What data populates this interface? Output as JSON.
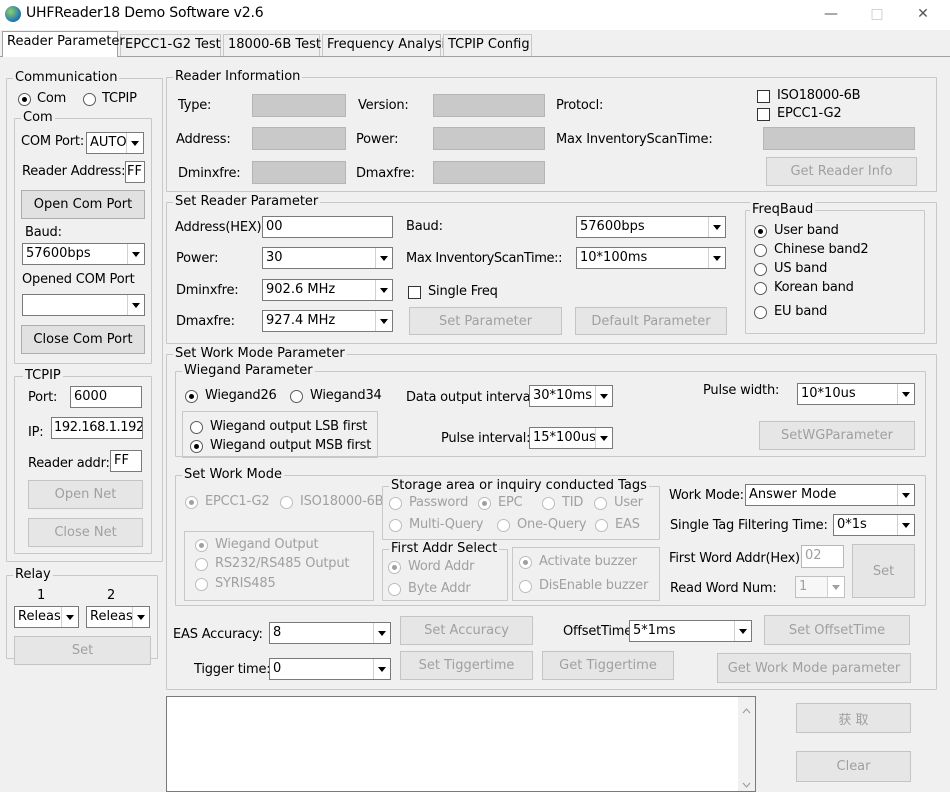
{
  "window": {
    "title": "UHFReader18 Demo Software v2.6",
    "controls": {
      "minimize": "—",
      "maximize": "□",
      "close": "✕"
    }
  },
  "tabs": [
    "Reader Parameter",
    "EPCC1-G2 Test",
    "18000-6B Test",
    "Frequency Analysis",
    "TCPIP Config"
  ],
  "communication": {
    "title": "Communication",
    "mode_com": "Com",
    "mode_tcpip": "TCPIP",
    "com": {
      "title": "Com",
      "com_port_label": "COM Port:",
      "com_port_value": "AUTO",
      "reader_address_label": "Reader Address:",
      "reader_address_value": "FF",
      "open_btn": "Open Com Port",
      "baud_label": "Baud:",
      "baud_value": "57600bps",
      "opened_label": "Opened COM Port",
      "opened_value": "",
      "close_btn": "Close Com Port"
    },
    "tcpip": {
      "title": "TCPIP",
      "port_label": "Port:",
      "port_value": "6000",
      "ip_label": "IP:",
      "ip_value": "192.168.1.192",
      "addr_label": "Reader addr:",
      "addr_value": "FF",
      "open_btn": "Open Net",
      "close_btn": "Close Net"
    }
  },
  "relay": {
    "title": "Relay",
    "col1": "1",
    "col2": "2",
    "relay1_value": "Release",
    "relay2_value": "Release",
    "set_btn": "Set"
  },
  "reader_info": {
    "title": "Reader Information",
    "type_label": "Type:",
    "version_label": "Version:",
    "protocol_label": "Protocl:",
    "address_label": "Address:",
    "power_label": "Power:",
    "max_scan_label": "Max InventoryScanTime:",
    "dminfre_label": "Dminxfre:",
    "dmaxfre_label": "Dmaxfre:",
    "iso_label": "ISO18000-6B",
    "epc_label": "EPCC1-G2",
    "get_info_btn": "Get Reader Info"
  },
  "set_reader": {
    "title": "Set Reader Parameter",
    "address_label": "Address(HEX):",
    "address_value": "00",
    "baud_label": "Baud:",
    "baud_value": "57600bps",
    "power_label": "Power:",
    "power_value": "30",
    "max_scan_label": "Max InventoryScanTime::",
    "max_scan_value": "10*100ms",
    "dminfre_label": "Dminxfre:",
    "dminfre_value": "902.6 MHz",
    "single_freq_label": "Single Freq",
    "dmaxfre_label": "Dmaxfre:",
    "dmaxfre_value": "927.4 MHz",
    "set_btn": "Set Parameter",
    "default_btn": "Default Parameter",
    "freqband": {
      "title": "FreqBaud",
      "options": [
        "User band",
        "Chinese band2",
        "US band",
        "Korean band",
        "EU band"
      ]
    }
  },
  "work_mode": {
    "title": "Set Work Mode Parameter",
    "wiegand": {
      "title": "Wiegand Parameter",
      "w26": "Wiegand26",
      "w34": "Wiegand34",
      "lsb": "Wiegand output LSB first",
      "msb": "Wiegand output MSB first",
      "data_interval_label": "Data output interval:",
      "data_interval_value": "30*10ms",
      "pulse_width_label": "Pulse width:",
      "pulse_width_value": "10*10us",
      "pulse_interval_label": "Pulse interval:",
      "pulse_interval_value": "15*100us",
      "set_btn": "SetWGParameter"
    },
    "set_mode": {
      "title": "Set Work Mode",
      "epc": "EPCC1-G2",
      "iso": "ISO18000-6B",
      "wiegand_out": "Wiegand Output",
      "rs232": "RS232/RS485 Output",
      "syris": "SYRIS485",
      "storage": {
        "title": "Storage area or inquiry conducted Tags",
        "password": "Password",
        "epc": "EPC",
        "tid": "TID",
        "user": "User",
        "multi": "Multi-Query",
        "one": "One-Query",
        "eas": "EAS"
      },
      "first_addr": {
        "title": "First Addr Select",
        "word": "Word Addr",
        "byte": "Byte Addr"
      },
      "buzzer": {
        "activate": "Activate buzzer",
        "disable": "DisEnable buzzer"
      },
      "work_mode_label": "Work Mode:",
      "work_mode_value": "Answer Mode",
      "filter_label": "Single Tag Filtering Time:",
      "filter_value": "0*1s",
      "first_word_label": "First Word Addr(Hex):",
      "first_word_value": "02",
      "read_word_label": "Read Word Num:",
      "read_word_value": "1",
      "set_btn": "Set"
    },
    "eas_label": "EAS Accuracy:",
    "eas_value": "8",
    "set_accuracy_btn": "Set Accuracy",
    "offset_label": "OffsetTime:",
    "offset_value": "5*1ms",
    "set_offset_btn": "Set OffsetTime",
    "trigger_label": "Tigger time:",
    "trigger_value": "0",
    "set_trigger_btn": "Set Tiggertime",
    "get_trigger_btn": "Get Tiggertime",
    "get_mode_btn": "Get Work Mode parameter"
  },
  "bottom": {
    "get_btn": "获 取",
    "clear_btn": "Clear"
  }
}
